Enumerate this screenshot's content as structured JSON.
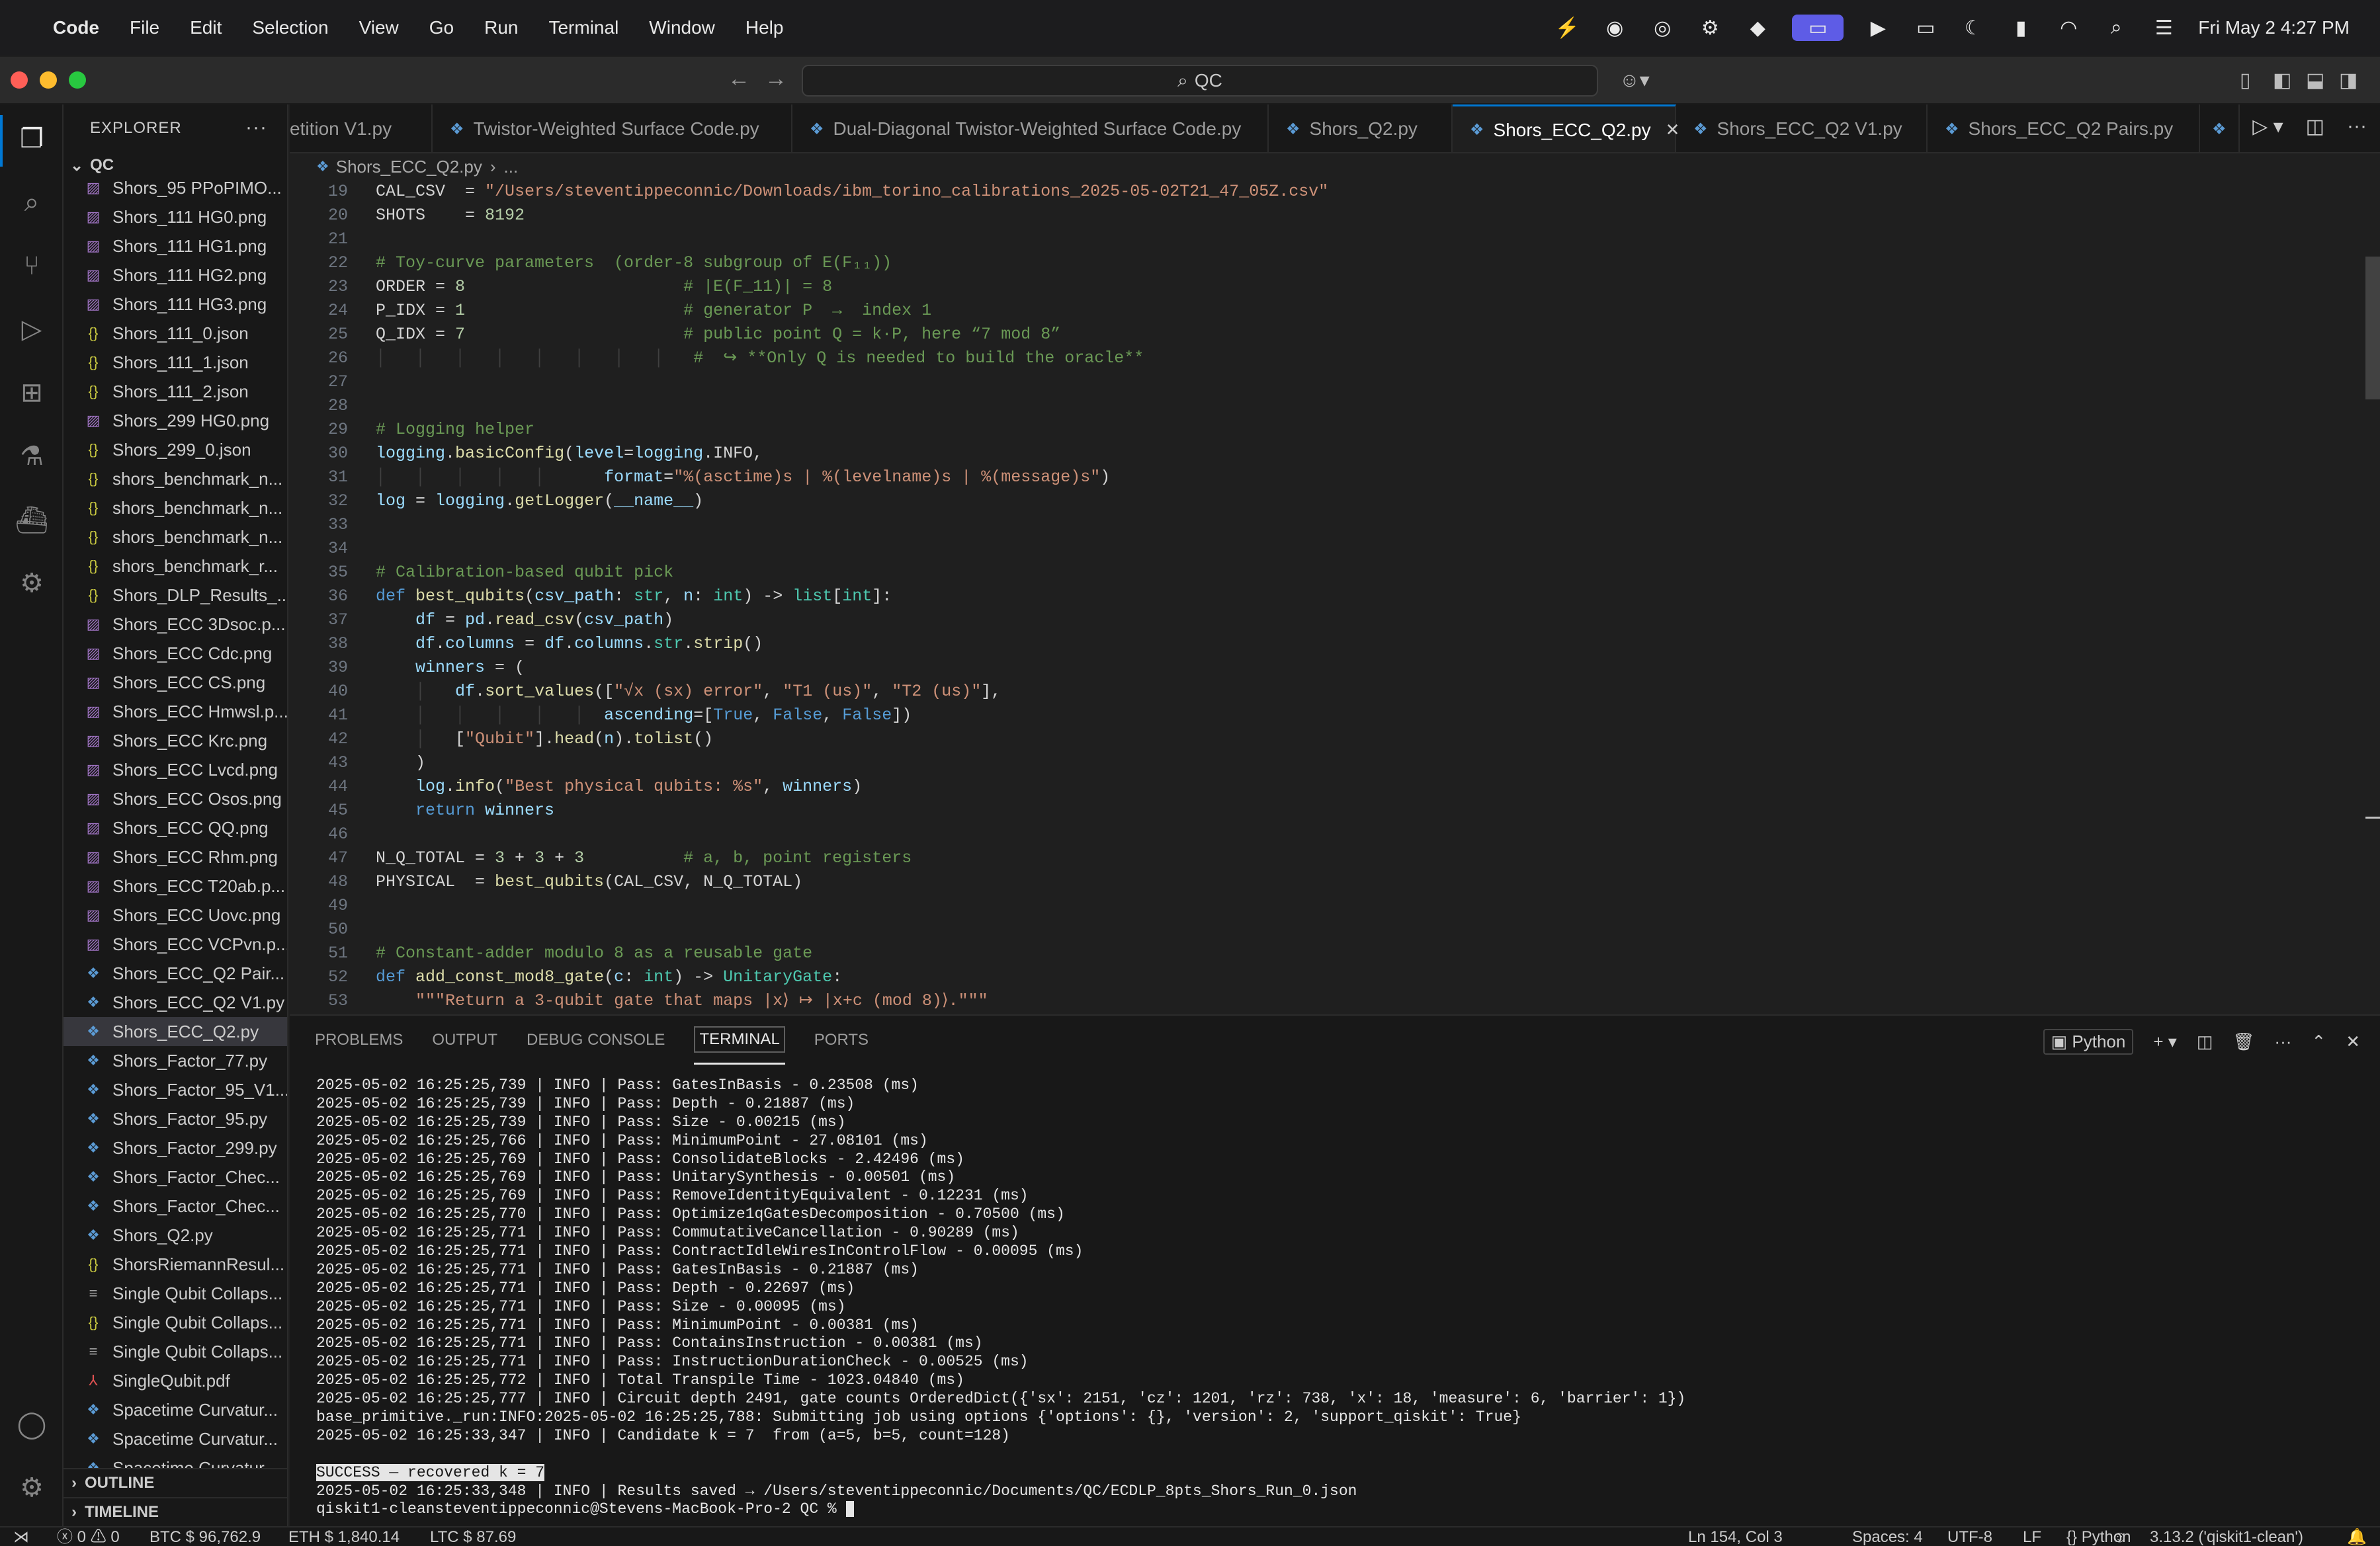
{
  "menubar": {
    "app": "Code",
    "items": [
      "File",
      "Edit",
      "Selection",
      "View",
      "Go",
      "Run",
      "Terminal",
      "Window",
      "Help"
    ],
    "clock": "Fri May 2  4:27 PM"
  },
  "titlebar": {
    "search": "QC",
    "traffic_colors": [
      "#ff5f57",
      "#febc2e",
      "#28c840"
    ]
  },
  "explorer": {
    "title": "EXPLORER",
    "root": "QC",
    "files": [
      {
        "name": "Shors_95 PPoPIMO...",
        "type": "png"
      },
      {
        "name": "Shors_111 HG0.png",
        "type": "png"
      },
      {
        "name": "Shors_111 HG1.png",
        "type": "png"
      },
      {
        "name": "Shors_111 HG2.png",
        "type": "png"
      },
      {
        "name": "Shors_111 HG3.png",
        "type": "png"
      },
      {
        "name": "Shors_111_0.json",
        "type": "json"
      },
      {
        "name": "Shors_111_1.json",
        "type": "json"
      },
      {
        "name": "Shors_111_2.json",
        "type": "json"
      },
      {
        "name": "Shors_299 HG0.png",
        "type": "png"
      },
      {
        "name": "Shors_299_0.json",
        "type": "json"
      },
      {
        "name": "shors_benchmark_n...",
        "type": "json"
      },
      {
        "name": "shors_benchmark_n...",
        "type": "json"
      },
      {
        "name": "shors_benchmark_n...",
        "type": "json"
      },
      {
        "name": "shors_benchmark_r...",
        "type": "json"
      },
      {
        "name": "Shors_DLP_Results_...",
        "type": "json"
      },
      {
        "name": "Shors_ECC 3Dsoc.p...",
        "type": "png"
      },
      {
        "name": "Shors_ECC Cdc.png",
        "type": "png"
      },
      {
        "name": "Shors_ECC CS.png",
        "type": "png"
      },
      {
        "name": "Shors_ECC Hmwsl.p...",
        "type": "png"
      },
      {
        "name": "Shors_ECC Krc.png",
        "type": "png"
      },
      {
        "name": "Shors_ECC Lvcd.png",
        "type": "png"
      },
      {
        "name": "Shors_ECC Osos.png",
        "type": "png"
      },
      {
        "name": "Shors_ECC QQ.png",
        "type": "png"
      },
      {
        "name": "Shors_ECC Rhm.png",
        "type": "png"
      },
      {
        "name": "Shors_ECC T20ab.p...",
        "type": "png"
      },
      {
        "name": "Shors_ECC Uovc.png",
        "type": "png"
      },
      {
        "name": "Shors_ECC VCPvn.p...",
        "type": "png"
      },
      {
        "name": "Shors_ECC_Q2 Pair...",
        "type": "py"
      },
      {
        "name": "Shors_ECC_Q2 V1.py",
        "type": "py"
      },
      {
        "name": "Shors_ECC_Q2.py",
        "type": "py",
        "selected": true
      },
      {
        "name": "Shors_Factor_77.py",
        "type": "py"
      },
      {
        "name": "Shors_Factor_95_V1...",
        "type": "py"
      },
      {
        "name": "Shors_Factor_95.py",
        "type": "py"
      },
      {
        "name": "Shors_Factor_299.py",
        "type": "py"
      },
      {
        "name": "Shors_Factor_Chec...",
        "type": "py"
      },
      {
        "name": "Shors_Factor_Chec...",
        "type": "py"
      },
      {
        "name": "Shors_Q2.py",
        "type": "py"
      },
      {
        "name": "ShorsRiemannResul...",
        "type": "json"
      },
      {
        "name": "Single Qubit Collaps...",
        "type": "txt"
      },
      {
        "name": "Single Qubit Collaps...",
        "type": "json"
      },
      {
        "name": "Single Qubit Collaps...",
        "type": "txt"
      },
      {
        "name": "SingleQubit.pdf",
        "type": "pdf"
      },
      {
        "name": "Spacetime Curvatur...",
        "type": "py"
      },
      {
        "name": "Spacetime Curvatur...",
        "type": "py"
      },
      {
        "name": "Spacetime Curvatur...",
        "type": "py"
      }
    ],
    "outline": "OUTLINE",
    "timeline": "TIMELINE"
  },
  "tabs": [
    {
      "label": "etition V1.py"
    },
    {
      "label": "Twistor-Weighted Surface Code.py"
    },
    {
      "label": "Dual-Diagonal Twistor-Weighted Surface Code.py"
    },
    {
      "label": "Shors_Q2.py"
    },
    {
      "label": "Shors_ECC_Q2.py",
      "active": true
    },
    {
      "label": "Shors_ECC_Q2 V1.py"
    },
    {
      "label": "Shors_ECC_Q2 Pairs.py"
    }
  ],
  "breadcrumb": {
    "file": "Shors_ECC_Q2.py",
    "more": "..."
  },
  "editor": {
    "line_numbers": [
      "19",
      "20",
      "21",
      "22",
      "23",
      "24",
      "25",
      "26",
      "27",
      "28",
      "29",
      "30",
      "31",
      "32",
      "33",
      "34",
      "35",
      "36",
      "37",
      "38",
      "39",
      "40",
      "41",
      "42",
      "43",
      "44",
      "45",
      "46",
      "47",
      "48",
      "49",
      "50",
      "51",
      "52",
      "53"
    ],
    "lines": [
      "CAL_CSV  = \"/Users/steventippeconnic/Downloads/ibm_torino_calibrations_2025-05-02T21_47_05Z.csv\"",
      "SHOTS    = 8192",
      "",
      "# Toy-curve parameters  (order-8 subgroup of E(F₁₁))",
      "ORDER = 8                      # |E(F_11)| = 8",
      "P_IDX = 1                      # generator P  →  index 1",
      "Q_IDX = 7                      # public point Q = k·P, here “7 mod 8”",
      "│   │   │   │   │   │   │   │   #  ↪ **Only Q is needed to build the oracle**",
      "",
      "",
      "# Logging helper",
      "logging.basicConfig(level=logging.INFO,",
      "│   │   │   │   │      format=\"%(asctime)s | %(levelname)s | %(message)s\")",
      "log = logging.getLogger(__name__)",
      "",
      "",
      "# Calibration-based qubit pick",
      "def best_qubits(csv_path: str, n: int) -> list[int]:",
      "    df = pd.read_csv(csv_path)",
      "    df.columns = df.columns.str.strip()",
      "    winners = (",
      "    │   df.sort_values([\"√x (sx) error\", \"T1 (us)\", \"T2 (us)\"],",
      "    │   │   │   │   │  ascending=[True, False, False])",
      "    │   [\"Qubit\"].head(n).tolist()",
      "    )",
      "    log.info(\"Best physical qubits: %s\", winners)",
      "    return winners",
      "",
      "N_Q_TOTAL = 3 + 3 + 3          # a, b, point registers",
      "PHYSICAL  = best_qubits(CAL_CSV, N_Q_TOTAL)",
      "",
      "",
      "# Constant-adder modulo 8 as a reusable gate",
      "def add_const_mod8_gate(c: int) -> UnitaryGate:",
      "    \"\"\"Return a 3-qubit gate that maps |x⟩ ↦ |x+c (mod 8)⟩.\"\"\""
    ]
  },
  "panel": {
    "tabs": [
      "PROBLEMS",
      "OUTPUT",
      "DEBUG CONSOLE",
      "TERMINAL",
      "PORTS"
    ],
    "active_tab": "TERMINAL",
    "shell": "Python",
    "terminal_lines": [
      "2025-05-02 16:25:25,739 | INFO | Pass: GatesInBasis - 0.23508 (ms)",
      "2025-05-02 16:25:25,739 | INFO | Pass: Depth - 0.21887 (ms)",
      "2025-05-02 16:25:25,739 | INFO | Pass: Size - 0.00215 (ms)",
      "2025-05-02 16:25:25,766 | INFO | Pass: MinimumPoint - 27.08101 (ms)",
      "2025-05-02 16:25:25,769 | INFO | Pass: ConsolidateBlocks - 2.42496 (ms)",
      "2025-05-02 16:25:25,769 | INFO | Pass: UnitarySynthesis - 0.00501 (ms)",
      "2025-05-02 16:25:25,769 | INFO | Pass: RemoveIdentityEquivalent - 0.12231 (ms)",
      "2025-05-02 16:25:25,770 | INFO | Pass: Optimize1qGatesDecomposition - 0.70500 (ms)",
      "2025-05-02 16:25:25,771 | INFO | Pass: CommutativeCancellation - 0.90289 (ms)",
      "2025-05-02 16:25:25,771 | INFO | Pass: ContractIdleWiresInControlFlow - 0.00095 (ms)",
      "2025-05-02 16:25:25,771 | INFO | Pass: GatesInBasis - 0.21887 (ms)",
      "2025-05-02 16:25:25,771 | INFO | Pass: Depth - 0.22697 (ms)",
      "2025-05-02 16:25:25,771 | INFO | Pass: Size - 0.00095 (ms)",
      "2025-05-02 16:25:25,771 | INFO | Pass: MinimumPoint - 0.00381 (ms)",
      "2025-05-02 16:25:25,771 | INFO | Pass: ContainsInstruction - 0.00381 (ms)",
      "2025-05-02 16:25:25,771 | INFO | Pass: InstructionDurationCheck - 0.00525 (ms)",
      "2025-05-02 16:25:25,772 | INFO | Total Transpile Time - 1023.04840 (ms)",
      "2025-05-02 16:25:25,777 | INFO | Circuit depth 2491, gate counts OrderedDict({'sx': 2151, 'cz': 1201, 'rz': 738, 'x': 18, 'measure': 6, 'barrier': 1})",
      "base_primitive._run:INFO:2025-05-02 16:25:25,788: Submitting job using options {'options': {}, 'version': 2, 'support_qiskit': True}",
      "2025-05-02 16:25:33,347 | INFO | Candidate k = 7  from (a=5, b=5, count=128)",
      "",
      "SUCCESS — recovered k = 7",
      "2025-05-02 16:25:33,348 | INFO | Results saved → /Users/steventippeconnic/Documents/QC/ECDLP_8pts_Shors_Run_0.json",
      "qiskit1-cleansteventippeconnic@Stevens-MacBook-Pro-2 QC % "
    ]
  },
  "statusbar": {
    "errors": "0",
    "warnings": "0",
    "btc": "BTC $ 96,762.9",
    "eth": "ETH $ 1,840.14",
    "ltc": "LTC $ 87.69",
    "position": "Ln 154, Col 3",
    "spaces": "Spaces: 4",
    "encoding": "UTF-8",
    "eol": "LF",
    "language": "Python",
    "interpreter": "3.13.2 ('qiskit1-clean')"
  }
}
